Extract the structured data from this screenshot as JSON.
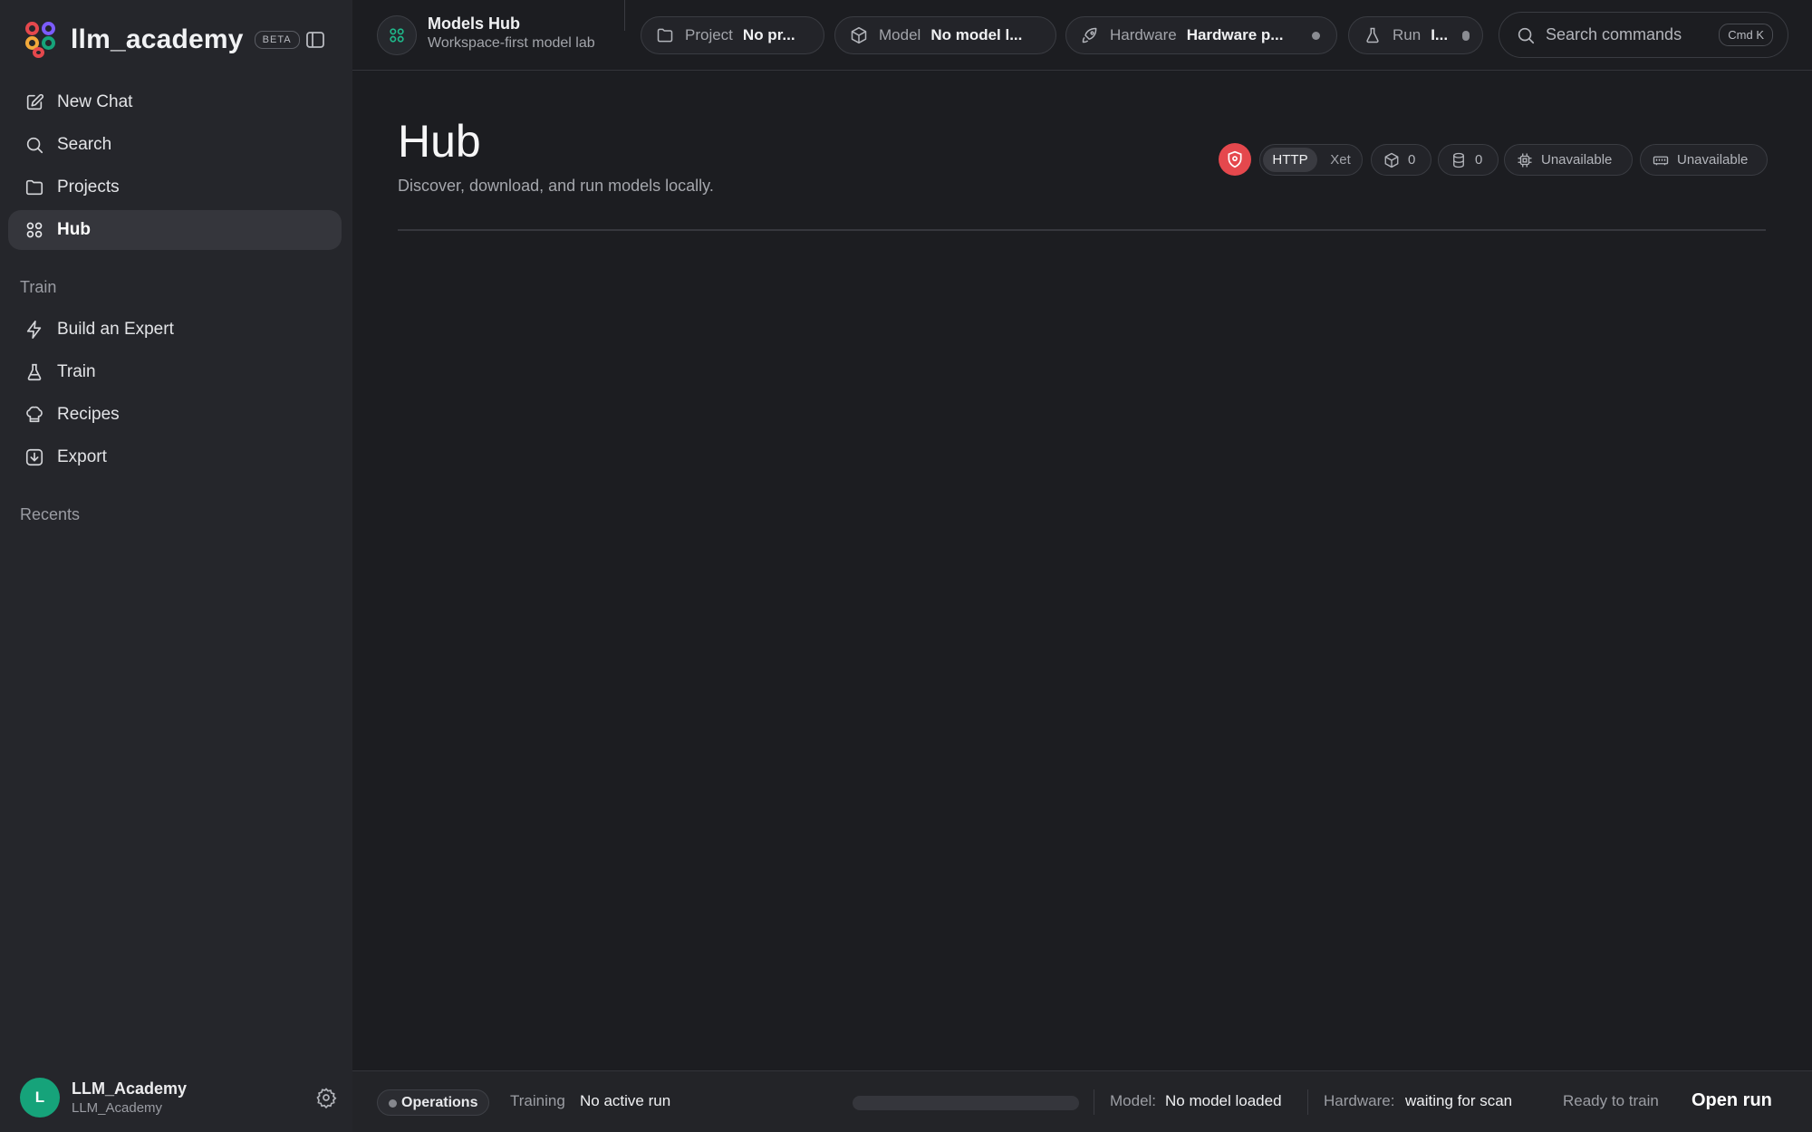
{
  "brand": {
    "name": "llm_academy",
    "badge": "BETA"
  },
  "sidebar": {
    "items": [
      {
        "label": "New Chat",
        "icon": "pencil-square-icon"
      },
      {
        "label": "Search",
        "icon": "search-icon"
      },
      {
        "label": "Projects",
        "icon": "folder-icon"
      },
      {
        "label": "Hub",
        "icon": "grid-circles-icon",
        "active": true
      }
    ],
    "train_section": "Train",
    "train_items": [
      {
        "label": "Build an Expert",
        "icon": "bolt-icon"
      },
      {
        "label": "Train",
        "icon": "flask-icon"
      },
      {
        "label": "Recipes",
        "icon": "chef-hat-icon"
      },
      {
        "label": "Export",
        "icon": "download-icon"
      }
    ],
    "recents_section": "Recents"
  },
  "user": {
    "initial": "L",
    "name": "LLM_Academy",
    "handle": "LLM_Academy"
  },
  "topbar": {
    "workspace_title": "Models Hub",
    "workspace_subtitle": "Workspace-first model lab",
    "chips": {
      "project": {
        "key": "Project",
        "value": "No pr..."
      },
      "model": {
        "key": "Model",
        "value": "No model l..."
      },
      "hardware": {
        "key": "Hardware",
        "value": "Hardware p..."
      },
      "run": {
        "key": "Run",
        "value": "I..."
      }
    },
    "search_placeholder": "Search commands",
    "search_shortcut": "Cmd K"
  },
  "page": {
    "title": "Hub",
    "subtitle": "Discover, download, and run models locally.",
    "transfer_toggle": {
      "selected": "HTTP",
      "other": "Xet"
    },
    "model_count": "0",
    "storage_count": "0",
    "cpu_status": "Unavailable",
    "memory_status": "Unavailable"
  },
  "statusbar": {
    "operations": "Operations",
    "training_label": "Training",
    "training_value": "No active run",
    "progress": 0,
    "model_label": "Model:",
    "model_value": "No model loaded",
    "hardware_label": "Hardware:",
    "hardware_value": "waiting for scan",
    "ready_text": "Ready to train",
    "open_run": "Open run"
  },
  "colors": {
    "accent_green": "#16a37a",
    "alert_red": "#e5484d",
    "background": "#1c1d21",
    "sidebar": "#25262b"
  }
}
